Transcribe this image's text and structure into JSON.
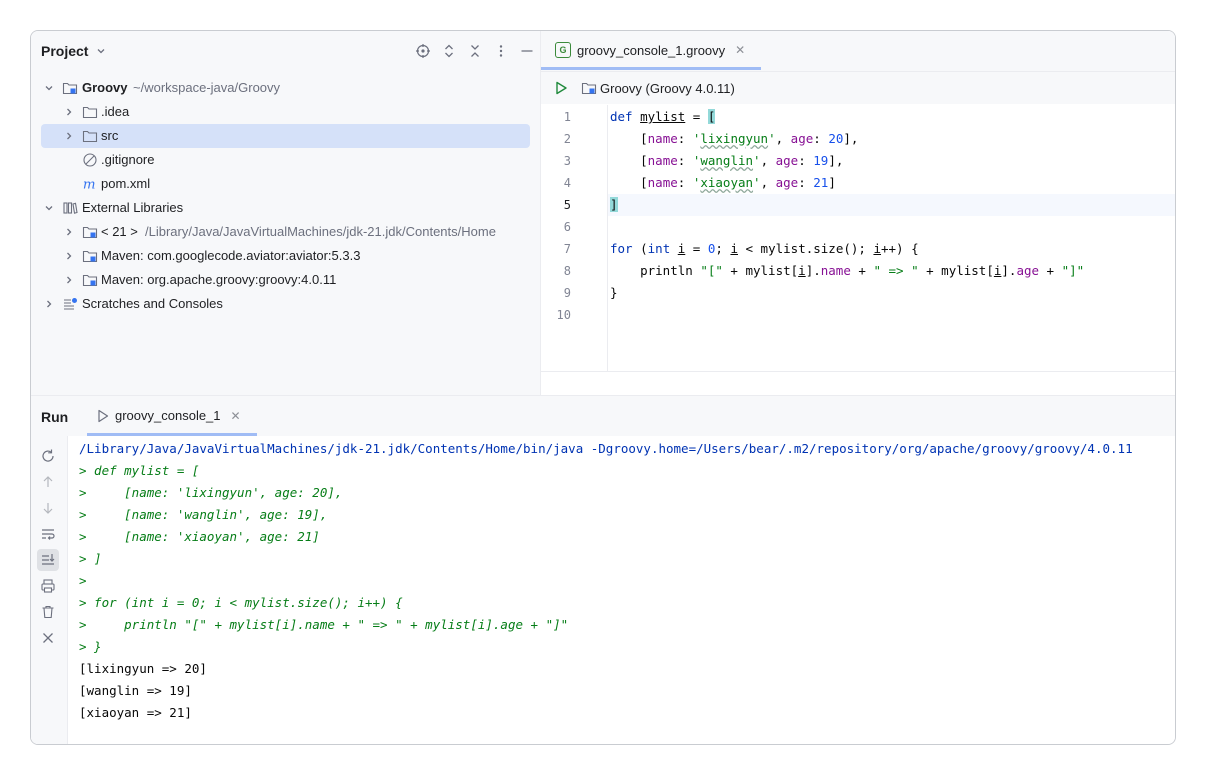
{
  "project": {
    "title": "Project",
    "tree": [
      {
        "label": "Groovy",
        "detail": "~/workspace-java/Groovy"
      },
      {
        "label": ".idea"
      },
      {
        "label": "src"
      },
      {
        "label": ".gitignore"
      },
      {
        "label": "pom.xml"
      },
      {
        "label": "External Libraries"
      },
      {
        "label": "< 21 >",
        "detail": "/Library/Java/JavaVirtualMachines/jdk-21.jdk/Contents/Home"
      },
      {
        "label": "Maven: com.googlecode.aviator:aviator:5.3.3"
      },
      {
        "label": "Maven: org.apache.groovy:groovy:4.0.11"
      },
      {
        "label": "Scratches and Consoles"
      }
    ]
  },
  "editor": {
    "tab_label": "groovy_console_1.groovy",
    "run_config": "Groovy (Groovy 4.0.11)",
    "line_numbers": [
      "1",
      "2",
      "3",
      "4",
      "5",
      "6",
      "7",
      "8",
      "9",
      "10"
    ],
    "code": {
      "l1": [
        "def",
        " ",
        "mylist",
        " = ",
        "["
      ],
      "l2": [
        "    [",
        "name",
        ": ",
        "'",
        "lixingyun",
        "'",
        ", ",
        "age",
        ": ",
        "20",
        "],"
      ],
      "l3": [
        "    [",
        "name",
        ": ",
        "'",
        "wanglin",
        "'",
        ", ",
        "age",
        ": ",
        "19",
        "],"
      ],
      "l4": [
        "    [",
        "name",
        ": ",
        "'",
        "xiaoyan",
        "'",
        ", ",
        "age",
        ": ",
        "21",
        "]"
      ],
      "l5": [
        "]"
      ],
      "l7": [
        "for",
        " (",
        "int",
        " ",
        "i",
        " = ",
        "0",
        "; ",
        "i",
        " < mylist.size(); ",
        "i",
        "++) {"
      ],
      "l8": [
        "    println ",
        "\"[\"",
        " + mylist[",
        "i",
        "].",
        "name",
        " + ",
        "\" => \"",
        " + mylist[",
        "i",
        "].",
        "age",
        " + ",
        "\"]\""
      ],
      "l9": [
        "}"
      ]
    }
  },
  "run": {
    "title": "Run",
    "tab_label": "groovy_console_1",
    "console": [
      "/Library/Java/JavaVirtualMachines/jdk-21.jdk/Contents/Home/bin/java -Dgroovy.home=/Users/bear/.m2/repository/org/apache/groovy/groovy/4.0.11",
      "> def mylist = [",
      ">     [name: 'lixingyun', age: 20],",
      ">     [name: 'wanglin', age: 19],",
      ">     [name: 'xiaoyan', age: 21]",
      "> ]",
      ">",
      "> for (int i = 0; i < mylist.size(); i++) {",
      ">     println \"[\" + mylist[i].name + \" => \" + mylist[i].age + \"]\"",
      "> }",
      "[lixingyun => 20]",
      "[wanglin => 19]",
      "[xiaoyan => 21]"
    ]
  },
  "colors": {
    "accent": "#3574f0",
    "selection": "#d5e1f9",
    "keyword": "#0033b3",
    "string": "#067d17",
    "number": "#1750eb",
    "property": "#871094"
  },
  "icons": [
    "chevron-down-icon",
    "locate-icon",
    "expand-all-icon",
    "collapse-all-icon",
    "more-icon",
    "minimize-icon",
    "folder-icon",
    "module-icon",
    "ignore-file-icon",
    "maven-icon",
    "library-icon",
    "jdk-icon",
    "scratches-icon",
    "groovy-file-icon",
    "run-icon",
    "rerun-icon",
    "up-arrow-icon",
    "down-arrow-icon",
    "soft-wrap-icon",
    "scroll-to-end-icon",
    "print-icon",
    "trash-icon",
    "close-icon"
  ]
}
